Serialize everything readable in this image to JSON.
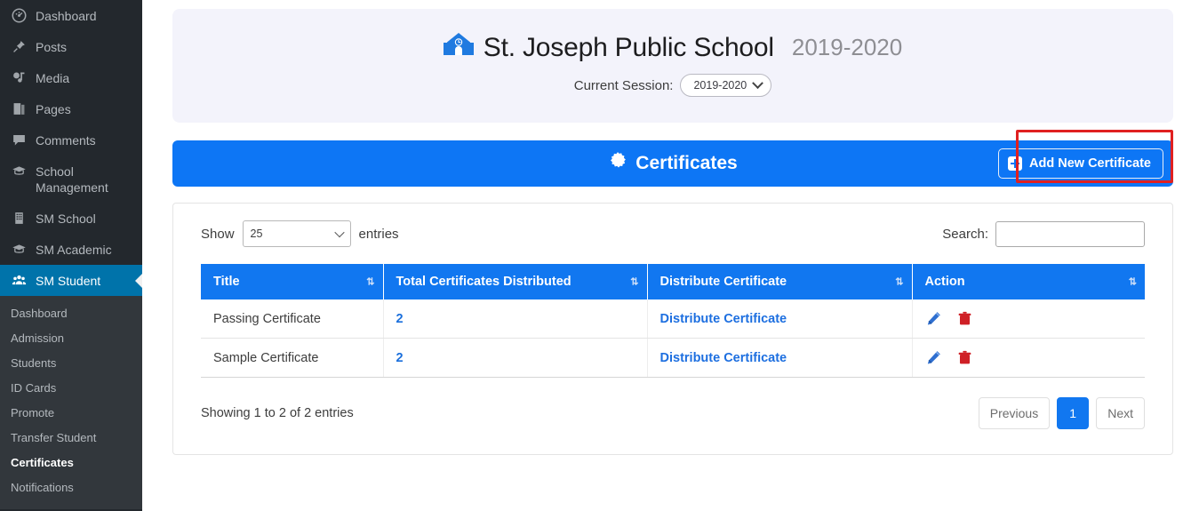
{
  "sidebar": {
    "items": [
      {
        "label": "Dashboard",
        "icon": "dashboard-icon"
      },
      {
        "label": "Posts",
        "icon": "pin-icon"
      },
      {
        "label": "Media",
        "icon": "media-icon"
      },
      {
        "label": "Pages",
        "icon": "pages-icon"
      },
      {
        "label": "Comments",
        "icon": "comment-icon"
      },
      {
        "label": "School Management",
        "icon": "graduation-cap-icon"
      },
      {
        "label": "SM School",
        "icon": "building-icon"
      },
      {
        "label": "SM Academic",
        "icon": "graduation-cap-icon"
      },
      {
        "label": "SM Student",
        "icon": "users-icon",
        "active": true
      }
    ],
    "submenu": [
      {
        "label": "Dashboard"
      },
      {
        "label": "Admission"
      },
      {
        "label": "Students"
      },
      {
        "label": "ID Cards"
      },
      {
        "label": "Promote"
      },
      {
        "label": "Transfer Student"
      },
      {
        "label": "Certificates",
        "current": true
      },
      {
        "label": "Notifications"
      }
    ]
  },
  "header": {
    "logo_icon": "school-building-icon",
    "school_name": "St. Joseph Public School",
    "school_year": "2019-2020",
    "session_label": "Current Session:",
    "session_value": "2019-2020",
    "background": "#f3f3fb"
  },
  "panel": {
    "icon": "certificate-seal-icon",
    "title": "Certificates",
    "add_button_label": "Add New Certificate",
    "add_button_icon": "plus-square-icon",
    "accent_color": "#0d76f5",
    "highlight_color": "#e02020"
  },
  "controls": {
    "show_label": "Show",
    "entries_label": "entries",
    "page_length": "25",
    "search_label": "Search:",
    "search_value": "",
    "search_placeholder": ""
  },
  "table": {
    "columns": [
      "Title",
      "Total Certificates Distributed",
      "Distribute Certificate",
      "Action"
    ],
    "sort_icon": "sort-updown-icon",
    "rows": [
      {
        "title": "Passing Certificate",
        "total": "2",
        "distribute": "Distribute Certificate",
        "edit_icon": "pencil-edit-icon",
        "delete_icon": "trash-delete-icon"
      },
      {
        "title": "Sample Certificate",
        "total": "2",
        "distribute": "Distribute Certificate",
        "edit_icon": "pencil-edit-icon",
        "delete_icon": "trash-delete-icon"
      }
    ]
  },
  "footer": {
    "info": "Showing 1 to 2 of 2 entries",
    "previous": "Previous",
    "page_current": "1",
    "next": "Next"
  }
}
